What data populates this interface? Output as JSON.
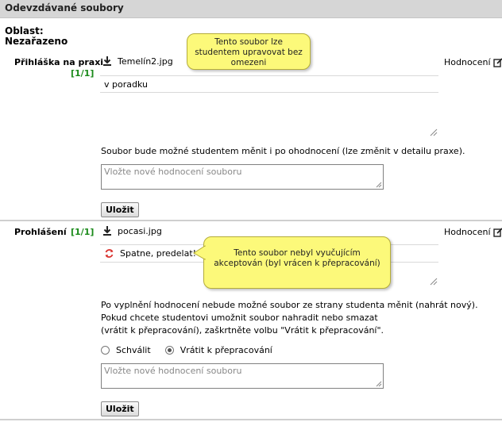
{
  "header": {
    "title": "Odevzdávané soubory"
  },
  "area": {
    "label": "Oblast:",
    "value": "Nezařazeno"
  },
  "files": [
    {
      "label": "Přihláška na praxi",
      "count": "[1/1]",
      "filename": "Temelín2.jpg",
      "rating_label": "Hodnocení",
      "comment": "v poradku",
      "note": "Soubor bude možné studentem měnit i po ohodnocení (lze změnit v detailu praxe).",
      "new_rating_placeholder": "Vložte nové hodnocení souboru",
      "save_label": "Uložit",
      "tooltip": "Tento soubor lze studentem upravovat bez omezeni"
    },
    {
      "label": "Prohlášení",
      "count": "[1/1]",
      "filename": "pocasi.jpg",
      "rating_label": "Hodnocení",
      "comment": "Spatne, predelat!",
      "note_lines": [
        "Po vyplnění hodnocení nebude možné soubor ze strany studenta měnit (nahrát nový).",
        "Pokud chcete studentovi umožnit soubor nahradit nebo smazat",
        "(vrátit k přepracování), zaškrtněte volbu \"Vrátit k přepracování\"."
      ],
      "radio_approve": "Schválit",
      "radio_return": "Vrátit k přepracování",
      "new_rating_placeholder": "Vložte nové hodnocení souboru",
      "save_label": "Uložit",
      "tooltip": "Tento soubor nebyl vyučujícím akceptován (byl vrácen k přepracování)"
    }
  ],
  "colors": {
    "count_green": "#1a8a1a",
    "tooltip_yellow": "#fcf97a",
    "reject_red": "#d9302c"
  }
}
